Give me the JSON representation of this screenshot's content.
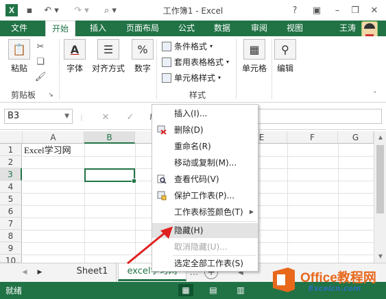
{
  "window": {
    "title": "工作簿1 - Excel",
    "help": "?"
  },
  "ribbon_tabs": [
    {
      "label": "文件"
    },
    {
      "label": "开始"
    },
    {
      "label": "插入"
    },
    {
      "label": "页面布局"
    },
    {
      "label": "公式"
    },
    {
      "label": "数据"
    },
    {
      "label": "审阅"
    },
    {
      "label": "视图"
    }
  ],
  "user": {
    "name": "王涛"
  },
  "ribbon": {
    "paste": "粘贴",
    "font": "字体",
    "alignment": "对齐方式",
    "number": "数字",
    "number_icon": "%",
    "conditional_format": "条件格式",
    "table_format": "套用表格格式",
    "cell_style": "单元格样式",
    "cells": "单元格",
    "editing": "编辑",
    "group_clipboard": "剪贴板",
    "group_styles": "样式"
  },
  "formula_bar": {
    "name_box": "B3",
    "fx": "fx",
    "cancel": "✕",
    "enter": "✓"
  },
  "grid": {
    "columns": [
      "A",
      "B",
      "C",
      "D",
      "E",
      "F",
      "G"
    ],
    "rows": [
      "1",
      "2",
      "3",
      "4",
      "5",
      "6",
      "7",
      "8",
      "9",
      "10"
    ],
    "cell_a1": "Excel学习网"
  },
  "sheets": {
    "tabs": [
      "Sheet1",
      "excel学习网"
    ],
    "ready": "就绪"
  },
  "context_menu": {
    "items": [
      {
        "label": "插入(I)..."
      },
      {
        "label": "删除(D)"
      },
      {
        "label": "重命名(R)"
      },
      {
        "label": "移动或复制(M)..."
      },
      {
        "label": "查看代码(V)"
      },
      {
        "label": "保护工作表(P)..."
      },
      {
        "label": "工作表标签颜色(T)"
      },
      {
        "label": "隐藏(H)"
      },
      {
        "label": "取消隐藏(U)..."
      },
      {
        "label": "选定全部工作表(S)"
      }
    ]
  },
  "watermark": {
    "brand": "Office教程网",
    "site": "Excelcn.com"
  },
  "colors": {
    "excel_green": "#217346",
    "arrow_red": "#e02020",
    "brand_orange": "#e8681c"
  }
}
